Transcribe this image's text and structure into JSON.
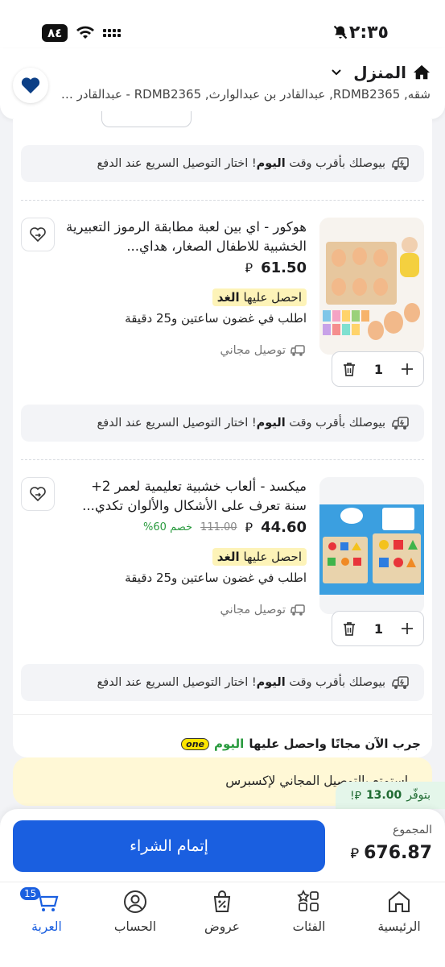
{
  "status": {
    "time": "٢:٣٥",
    "battery": "٨٤"
  },
  "header": {
    "title": "المنزل",
    "address": "شقه, RDMB2365, عبدالقادر بن عبدالوارث, RDMB2365 - عبدالقادر ب..."
  },
  "delivery_strip": {
    "prefix": "بيوصلك بأقرب وقت",
    "highlight": "اليوم",
    "suffix": "! اختار التوصيل السريع عند الدفع"
  },
  "products": [
    {
      "title": "هوكور - اي بين لعبة مطابقة الرموز التعبيرية الخشبية للاطفال الصغار، هداي...",
      "price": "61.50",
      "currency": "⃁",
      "badge_prefix": "احصل عليها",
      "badge_day": "الغد",
      "order_within": "اطلب في غضون ساعتين و25 دقيقة",
      "free_shipping": "توصيل مجاني",
      "quantity": "1"
    },
    {
      "title": "ميكسد - ألعاب خشبية تعليمية لعمر 2+ سنة تعرف على الأشكال والألوان تكدي...",
      "price": "44.60",
      "currency": "⃁",
      "old_price": "111.00",
      "discount": "خصم 60%",
      "badge_prefix": "احصل عليها",
      "badge_day": "الغد",
      "order_within": "اطلب في غضون ساعتين و25 دقيقة",
      "free_shipping": "توصيل مجاني",
      "quantity": "1"
    }
  ],
  "one_promo": {
    "text": "جرب الآن مجانًا واحصل عليها",
    "highlight": "اليوم",
    "badge": "one"
  },
  "express": {
    "text": "استمتع بالتوصيل المجاني لإكسبرس"
  },
  "savings": {
    "label": "بتوفّر",
    "amount": "13.00",
    "currency": "⃁!"
  },
  "checkout": {
    "total_label": "المجموع",
    "total": "676.87",
    "currency": "⃁",
    "button": "إتمام الشراء"
  },
  "nav": {
    "home": "الرئيسية",
    "categories": "الفئات",
    "deals": "عروض",
    "account": "الحساب",
    "cart": "العربة",
    "cart_count": "15"
  },
  "colors": {
    "accent": "#1a5fe0",
    "tomorrow_badge": "#fdf3b8",
    "express_banner": "#fff8d6",
    "discount": "#2a9b3f"
  }
}
